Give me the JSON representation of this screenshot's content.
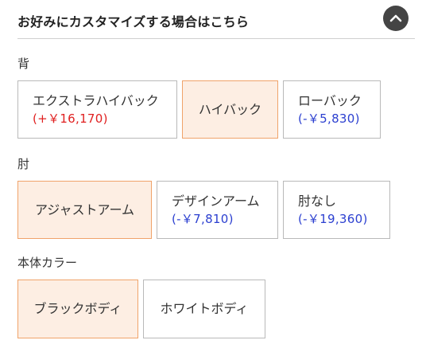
{
  "header": {
    "title": "お好みにカスタマイズする場合はこちら"
  },
  "colors": {
    "selected_bg": "#fdeee3",
    "selected_border": "#f0a36a",
    "price_plus": "#e02020",
    "price_minus": "#2b3fd0"
  },
  "sections": [
    {
      "label": "背",
      "options": [
        {
          "name": "エクストラハイバック",
          "price": "(+￥16,170)",
          "selected": false
        },
        {
          "name": "ハイバック",
          "price": "",
          "selected": true
        },
        {
          "name": "ローバック",
          "price": "(-￥5,830)",
          "selected": false
        }
      ]
    },
    {
      "label": "肘",
      "options": [
        {
          "name": "アジャストアーム",
          "price": "",
          "selected": true
        },
        {
          "name": "デザインアーム",
          "price": "(-￥7,810)",
          "selected": false
        },
        {
          "name": "肘なし",
          "price": "(-￥19,360)",
          "selected": false
        }
      ]
    },
    {
      "label": "本体カラー",
      "options": [
        {
          "name": "ブラックボディ",
          "price": "",
          "selected": true
        },
        {
          "name": "ホワイトボディ",
          "price": "",
          "selected": false
        }
      ]
    }
  ]
}
